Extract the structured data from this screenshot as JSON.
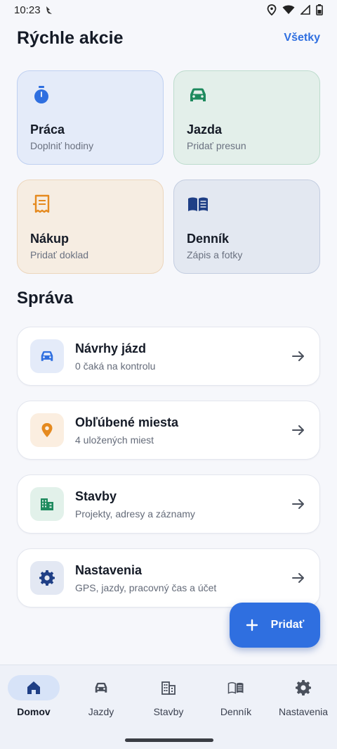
{
  "status": {
    "time": "10:23"
  },
  "header": {
    "title": "Rýchle akcie",
    "all_link": "Všetky"
  },
  "quick_actions": [
    {
      "title": "Práca",
      "subtitle": "Doplniť hodiny",
      "icon": "stopwatch-icon",
      "color": "#2f6fe0"
    },
    {
      "title": "Jazda",
      "subtitle": "Pridať presun",
      "icon": "car-icon",
      "color": "#1e8a5e"
    },
    {
      "title": "Nákup",
      "subtitle": "Pridať doklad",
      "icon": "receipt-icon",
      "color": "#e58a1f"
    },
    {
      "title": "Denník",
      "subtitle": "Zápis a fotky",
      "icon": "book-icon",
      "color": "#1f3f86"
    }
  ],
  "management": {
    "title": "Správa",
    "items": [
      {
        "title": "Návrhy jázd",
        "subtitle": "0 čaká na kontrolu",
        "icon": "car-icon",
        "color": "#2f6fe0",
        "bg": "#e4ebf9"
      },
      {
        "title": "Obľúbené miesta",
        "subtitle": "4 uložených miest",
        "icon": "location-pin-icon",
        "color": "#e58a1f",
        "bg": "#fbeee0"
      },
      {
        "title": "Stavby",
        "subtitle": "Projekty, adresy a záznamy",
        "icon": "buildings-icon",
        "color": "#1e8a5e",
        "bg": "#e2f1ea"
      },
      {
        "title": "Nastavenia",
        "subtitle": "GPS, jazdy, pracovný čas a účet",
        "icon": "gear-icon",
        "color": "#1f3f86",
        "bg": "#e3e8f3"
      }
    ]
  },
  "fab": {
    "label": "Pridať"
  },
  "nav": [
    {
      "label": "Domov",
      "icon": "home-icon",
      "active": true
    },
    {
      "label": "Jazdy",
      "icon": "car-icon",
      "active": false
    },
    {
      "label": "Stavby",
      "icon": "buildings-icon",
      "active": false
    },
    {
      "label": "Denník",
      "icon": "book-icon",
      "active": false
    },
    {
      "label": "Nastavenia",
      "icon": "gear-icon",
      "active": false
    }
  ]
}
